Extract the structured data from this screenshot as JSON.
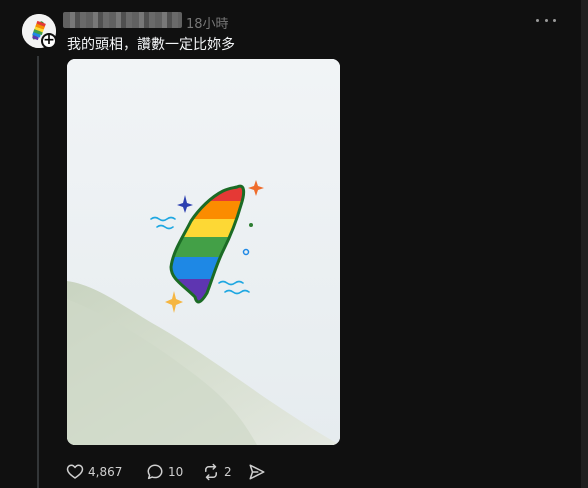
{
  "post": {
    "timestamp": "18小時",
    "text": "我的頭相，讚數一定比妳多",
    "image_icon": "rainbow-taiwan-drawing"
  },
  "actions": {
    "like_count": "4,867",
    "comment_count": "10",
    "repost_count": "2"
  },
  "icons": {
    "like": "heart-icon",
    "comment": "comment-bubble-icon",
    "repost": "repost-icon",
    "share": "send-icon",
    "more": "more-horizontal-icon",
    "follow": "plus-icon"
  },
  "colors": {
    "background": "#101010",
    "text": "#f3f5f7",
    "muted": "#777777",
    "thread_line": "#333638"
  }
}
